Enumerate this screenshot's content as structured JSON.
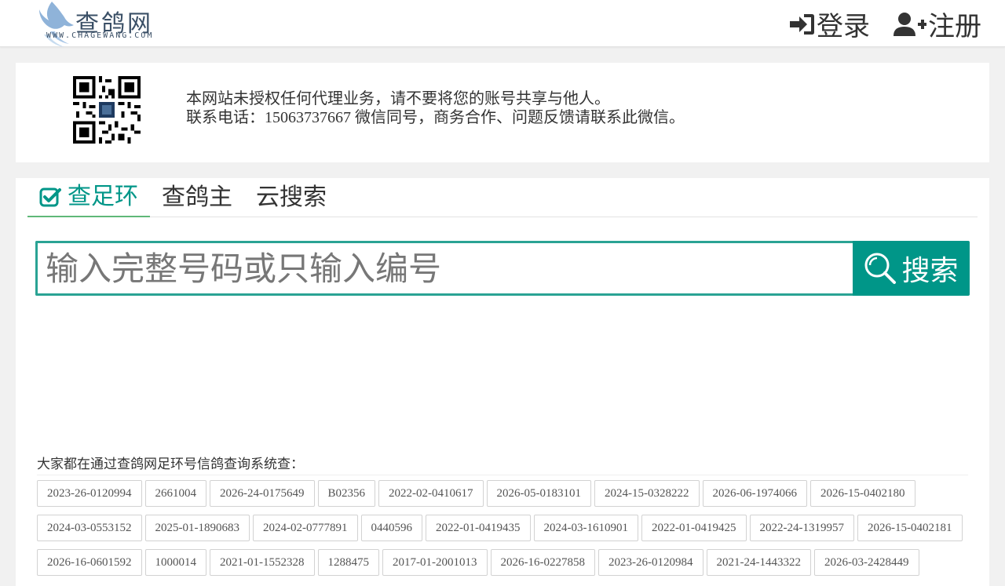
{
  "header": {
    "logo_cn": "查鸽网",
    "logo_en": "WWW.CHAGEWANG.COM",
    "login_label": "登录",
    "register_label": "注册"
  },
  "notice": {
    "line1": "本网站未授权任何代理业务，请不要将您的账号共享与他人。",
    "line2": "联系电话：15063737667 微信同号，商务合作、问题反馈请联系此微信。"
  },
  "tabs": [
    {
      "label": "查足环",
      "active": true
    },
    {
      "label": "查鸽主",
      "active": false
    },
    {
      "label": "云搜索",
      "active": false
    }
  ],
  "search": {
    "placeholder": "输入完整号码或只输入编号",
    "button_label": "搜索"
  },
  "popular": {
    "title": "大家都在通过查鸽网足环号信鸽查询系统查：",
    "tags": [
      "2023-26-0120994",
      "2661004",
      "2026-24-0175649",
      "B02356",
      "2022-02-0410617",
      "2026-05-0183101",
      "2024-15-0328222",
      "2026-06-1974066",
      "2026-15-0402180",
      "2024-03-0553152",
      "2025-01-1890683",
      "2024-02-0777891",
      "0440596",
      "2022-01-0419435",
      "2024-03-1610901",
      "2022-01-0419425",
      "2022-24-1319957",
      "2026-15-0402181",
      "2026-16-0601592",
      "1000014",
      "2021-01-1552328",
      "1288475",
      "2017-01-2001013",
      "2026-16-0227858",
      "2023-26-0120984",
      "2021-24-1443322",
      "2026-03-2428449"
    ]
  },
  "colors": {
    "accent": "#009688",
    "tab_underline": "#5fb878",
    "input_border": "#2aa394"
  }
}
